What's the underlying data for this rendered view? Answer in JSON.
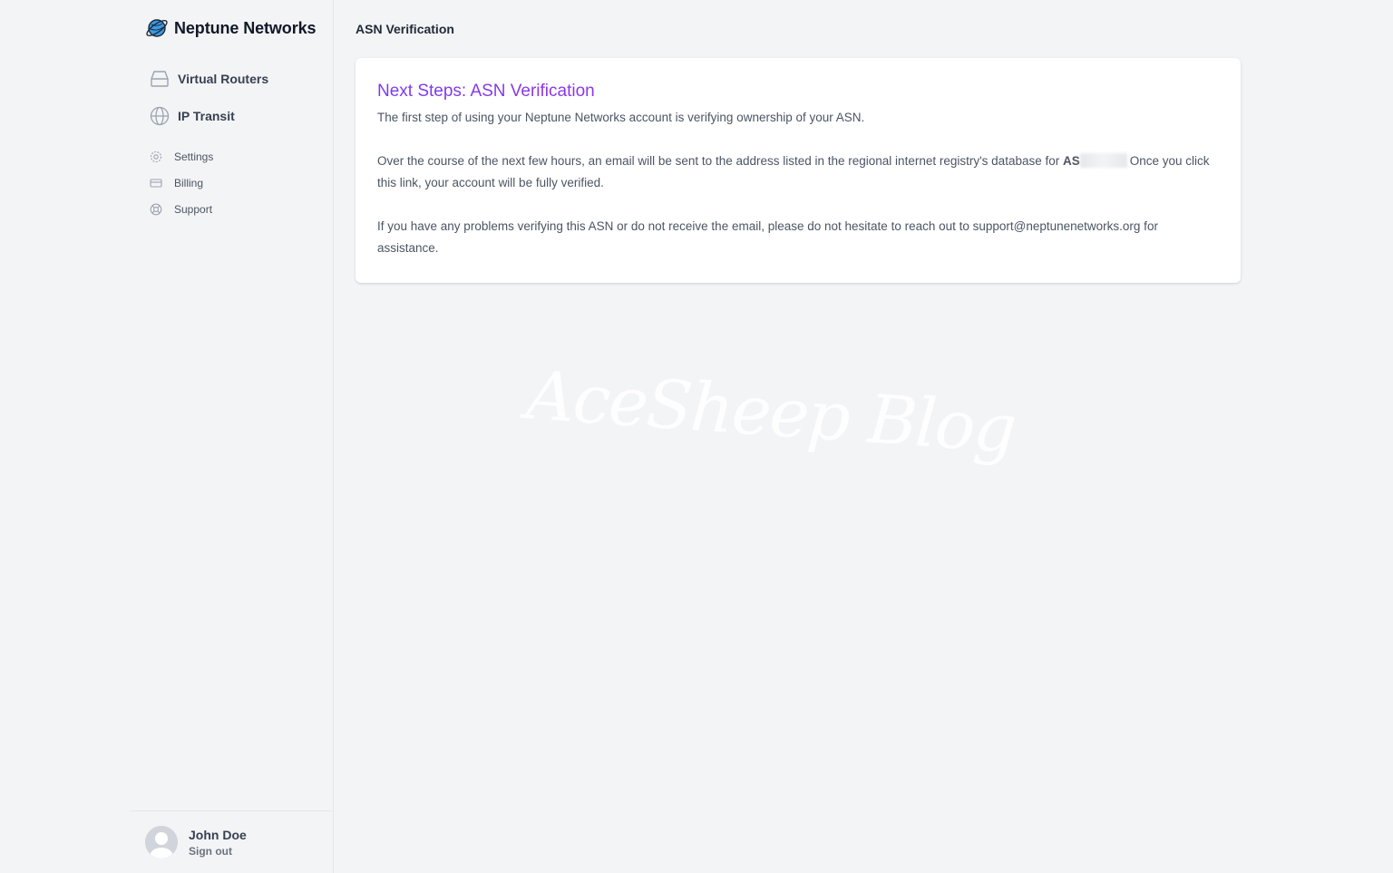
{
  "brand": {
    "name": "Neptune Networks"
  },
  "sidebar": {
    "main_items": [
      {
        "label": "Virtual Routers",
        "icon": "server-icon"
      },
      {
        "label": "IP Transit",
        "icon": "globe-icon"
      }
    ],
    "secondary_items": [
      {
        "label": "Settings",
        "icon": "gear-icon"
      },
      {
        "label": "Billing",
        "icon": "credit-card-icon"
      },
      {
        "label": "Support",
        "icon": "lifebuoy-icon"
      }
    ]
  },
  "user": {
    "name": "John Doe",
    "action": "Sign out"
  },
  "page": {
    "title": "ASN Verification"
  },
  "card": {
    "heading": "Next Steps: ASN Verification",
    "para1": "The first step of using your Neptune Networks account is verifying ownership of your ASN.",
    "para2_before": "Over the course of the next few hours, an email will be sent to the address listed in the regional internet registry's database for ",
    "asn_prefix": "AS",
    "para2_after": "Once you click this link, your account will be fully verified.",
    "para3": "If you have any problems verifying this ASN or do not receive the email, please do not hesitate to reach out to support@neptunenetworks.org for assistance."
  },
  "watermark": "AceSheep Blog",
  "colors": {
    "accent_start": "#7c3aed",
    "accent_end": "#c026d3",
    "background": "#f3f4f6"
  }
}
